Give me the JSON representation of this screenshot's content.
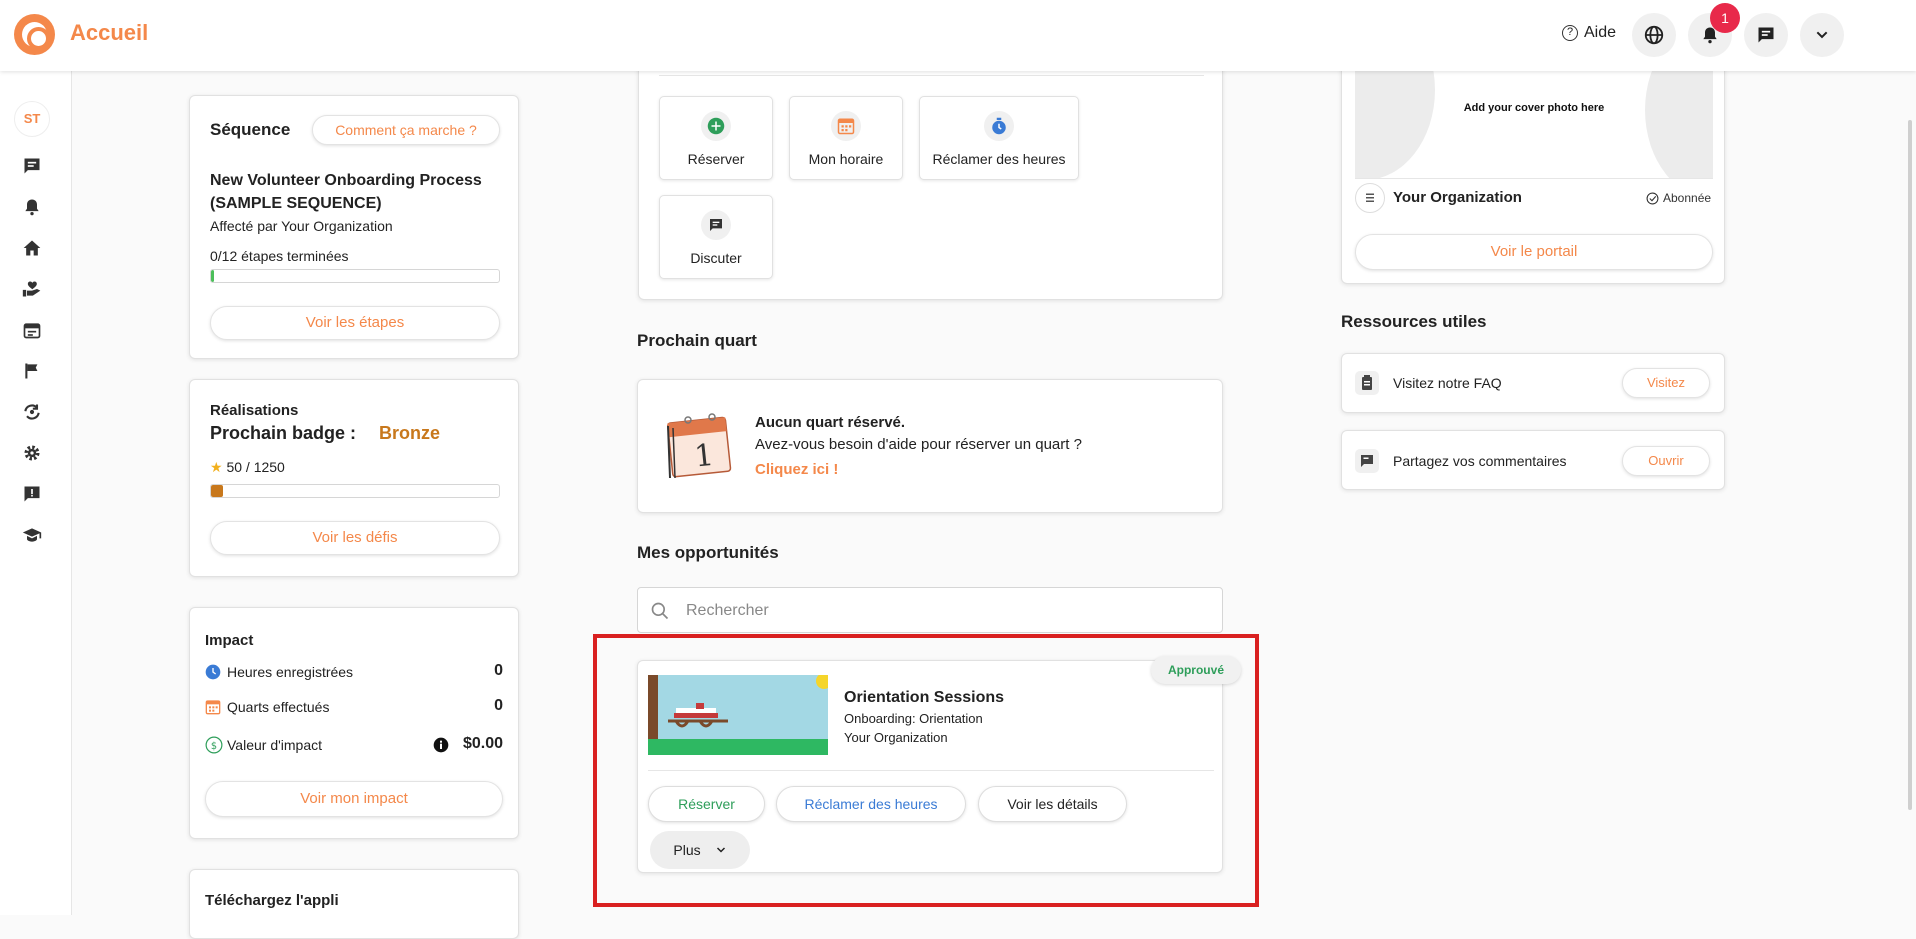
{
  "header": {
    "title": "Accueil",
    "help_label": "Aide",
    "notification_count": "1"
  },
  "sidebar": {
    "avatar_initials": "ST",
    "items": [
      "chat-icon",
      "bell-icon",
      "home-icon",
      "hand-heart-icon",
      "calendar-icon",
      "flag-icon",
      "refresh-icon",
      "gear-icon",
      "feedback-icon",
      "graduation-cap-icon"
    ]
  },
  "sequence": {
    "title": "Séquence",
    "how_button": "Comment ça marche ?",
    "name_line1": "New Volunteer Onboarding Process",
    "name_line2": "(SAMPLE SEQUENCE)",
    "assigned_by": "Affecté par Your Organization",
    "steps_done": "0/12 étapes terminées",
    "progress": 0.0,
    "view_steps_button": "Voir les étapes"
  },
  "achievements": {
    "title": "Réalisations",
    "next_badge_label": "Prochain badge :",
    "next_badge_value": "Bronze",
    "points": "50 / 1250",
    "progress": 0.04,
    "view_challenges_button": "Voir les défis"
  },
  "impact": {
    "title": "Impact",
    "rows": [
      {
        "label": "Heures enregistrées",
        "value": "0"
      },
      {
        "label": "Quarts effectués",
        "value": "0"
      },
      {
        "label": "Valeur d'impact",
        "value": "$0.00"
      }
    ],
    "view_impact_button": "Voir mon impact"
  },
  "download_app": {
    "title": "Téléchargez l'appli"
  },
  "quick_actions": [
    {
      "label": "Réserver",
      "icon": "plus-circle-icon"
    },
    {
      "label": "Mon horaire",
      "icon": "calendar-grid-icon"
    },
    {
      "label": "Réclamer des heures",
      "icon": "stopwatch-icon"
    },
    {
      "label": "Discuter",
      "icon": "chat-icon"
    }
  ],
  "next_shift": {
    "section_title": "Prochain quart",
    "calendar_day": "1",
    "heading": "Aucun quart réservé.",
    "subtext": "Avez-vous besoin d'aide pour réserver un quart ?",
    "link": "Cliquez ici !"
  },
  "opportunities": {
    "section_title": "Mes opportunités",
    "search_placeholder": "Rechercher",
    "items": [
      {
        "status": "Approuvé",
        "title": "Orientation Sessions",
        "subtitle": "Onboarding: Orientation",
        "organization": "Your Organization",
        "book_button": "Réserver",
        "claim_button": "Réclamer des heures",
        "details_button": "Voir les détails",
        "more_button": "Plus"
      }
    ]
  },
  "organization_card": {
    "cover_text": "Add your cover photo here",
    "name": "Your Organization",
    "follow_status": "Abonnée",
    "portal_button": "Voir le portail"
  },
  "resources": {
    "section_title": "Ressources utiles",
    "items": [
      {
        "label": "Visitez notre FAQ",
        "button": "Visitez"
      },
      {
        "label": "Partagez vos commentaires",
        "button": "Ouvrir"
      }
    ]
  },
  "colors": {
    "brand_orange": "#f4884a",
    "bronze": "#c8781c",
    "approved_green": "#2e9e5a",
    "link_blue": "#3a7bd5",
    "highlight_red": "#d92020"
  }
}
